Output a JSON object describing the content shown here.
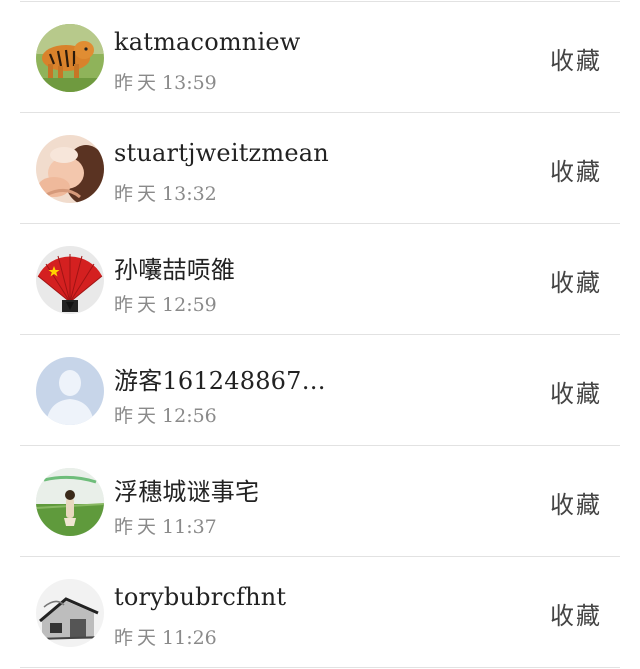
{
  "items": [
    {
      "name": "katmacomniew",
      "day": "昨天",
      "time": "13:59",
      "action": "收藏",
      "avatar_icon": "tiger-avatar"
    },
    {
      "name": "stuartjweitzmean",
      "day": "昨天",
      "time": "13:32",
      "action": "收藏",
      "avatar_icon": "person-photo-avatar"
    },
    {
      "name": "孙囔喆唝雒",
      "day": "昨天",
      "time": "12:59",
      "action": "收藏",
      "avatar_icon": "red-fan-avatar"
    },
    {
      "name": "游客161248867…",
      "day": "昨天",
      "time": "12:56",
      "action": "收藏",
      "avatar_icon": "default-user-avatar"
    },
    {
      "name": "浮穗城谜事宅",
      "day": "昨天",
      "time": "11:37",
      "action": "收藏",
      "avatar_icon": "girl-in-field-avatar"
    },
    {
      "name": "torybubrcfhnt",
      "day": "昨天",
      "time": "11:26",
      "action": "收藏",
      "avatar_icon": "house-sketch-avatar"
    }
  ]
}
